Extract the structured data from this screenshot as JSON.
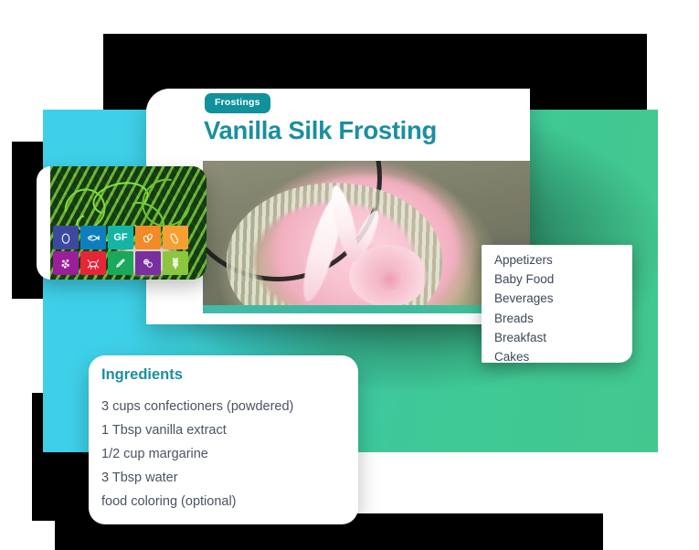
{
  "theme": {
    "teal_accent": "#1b8fa0",
    "badge_bg": "#10919b",
    "panel_cyan": "#3ed0e8",
    "panel_green": "#43c78f",
    "text_slate": "#3c4858",
    "card_white": "#ffffff"
  },
  "recipe_card": {
    "tag_label": "Frostings",
    "title": "Vanilla Silk Frosting",
    "hero_photo_name": "pink-frosted-cupcake-photo"
  },
  "thumb_card": {
    "photo_name": "green-bean-sprouts-photo",
    "allergen_icons": [
      {
        "name": "egg-icon",
        "glyph": "egg",
        "color": "#3c4a9e"
      },
      {
        "name": "fish-icon",
        "glyph": "fish",
        "color": "#0d7fbf"
      },
      {
        "name": "gluten-free-icon",
        "glyph": "GF",
        "color": "#14b5a6"
      },
      {
        "name": "tree-nuts-icon",
        "glyph": "nut",
        "color": "#f18b27"
      },
      {
        "name": "peanut-icon",
        "glyph": "peanut",
        "color": "#f6a033"
      },
      {
        "name": "sesame-icon",
        "glyph": "sesame",
        "color": "#9b1f9b"
      },
      {
        "name": "crustacean-icon",
        "glyph": "crab",
        "color": "#e62538"
      },
      {
        "name": "soy-icon",
        "glyph": "soy",
        "color": "#1aa85a"
      },
      {
        "name": "molluscs-icon",
        "glyph": "mollusc",
        "color": "#7a2f9e"
      },
      {
        "name": "wheat-icon",
        "glyph": "wheat",
        "color": "#8cc63f"
      }
    ]
  },
  "category_dropdown": {
    "items": [
      "Appetizers",
      "Baby Food",
      "Beverages",
      "Breads",
      "Breakfast",
      "Cakes"
    ]
  },
  "ingredients_card": {
    "heading": "Ingredients",
    "items": [
      "3 cups confectioners (powdered)",
      "1 Tbsp vanilla extract",
      "1/2 cup margarine",
      "3 Tbsp water",
      "food coloring (optional)"
    ]
  }
}
